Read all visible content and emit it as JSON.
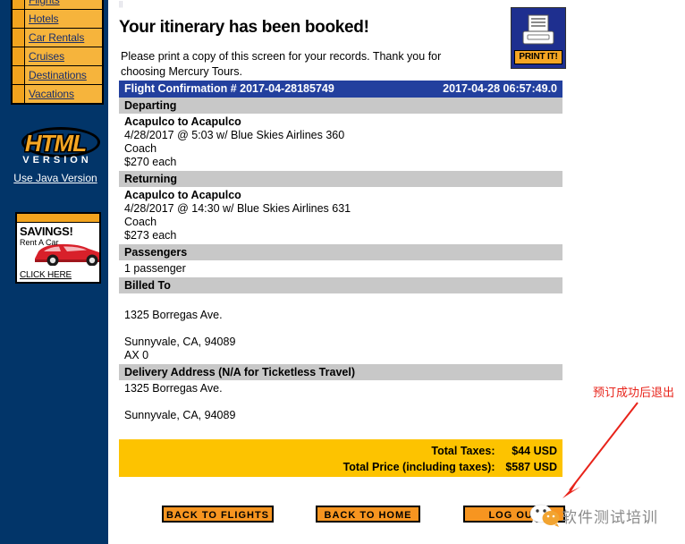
{
  "sidebar": {
    "nav_items": [
      {
        "label": "Flights"
      },
      {
        "label": "Hotels"
      },
      {
        "label": "Car Rentals"
      },
      {
        "label": "Cruises"
      },
      {
        "label": "Destinations"
      },
      {
        "label": "Vacations"
      }
    ],
    "logo": {
      "main_text": "HTML",
      "sub_text": "VERSION",
      "java_link": "Use Java Version"
    },
    "ad": {
      "title": "SAVINGS!",
      "subtitle": "Rent A Car",
      "cta": "CLICK HERE"
    },
    "bg_color": "#023569"
  },
  "main": {
    "page_title": "Your itinerary has been booked!",
    "note": "Please print a copy of this screen for your records. Thank you for choosing Mercury Tours.",
    "print_button": {
      "label": "PRINT IT!",
      "icon": "printer-icon",
      "bg_color": "#1e2f8f",
      "label_bg_color": "#f5a623"
    },
    "confirmation": {
      "title": "Flight Confirmation # 2017-04-28185749",
      "timestamp": "2017-04-28 06:57:49.0",
      "bar_color": "#23409e"
    },
    "sections": [
      {
        "heading": "Departing",
        "route": "Acapulco to Acapulco",
        "detail": "4/28/2017 @ 5:03 w/ Blue Skies Airlines 360",
        "cabin": "Coach",
        "price": "$270 each"
      },
      {
        "heading": "Returning",
        "route": "Acapulco to Acapulco",
        "detail": "4/28/2017 @ 14:30 w/ Blue Skies Airlines 631",
        "cabin": "Coach",
        "price": "$273 each"
      }
    ],
    "passengers": {
      "heading": "Passengers",
      "count_text": "1 passenger"
    },
    "billed_to": {
      "heading": "Billed To",
      "name": "",
      "street": "1325 Borregas Ave.",
      "line2": "",
      "city_state_zip": "Sunnyvale, CA, 94089",
      "card": "AX 0"
    },
    "delivery_address": {
      "heading": "Delivery Address (N/A for Ticketless Travel)",
      "street": "1325 Borregas Ave.",
      "line2": "",
      "city_state_zip": "Sunnyvale, CA, 94089"
    },
    "totals": {
      "taxes_label": "Total Taxes:",
      "taxes_value": "$44 USD",
      "price_label": "Total Price (including taxes):",
      "price_value": "$587 USD",
      "bg_color": "#fdc300"
    },
    "buttons": [
      {
        "label": "BACK TO FLIGHTS"
      },
      {
        "label": "BACK TO HOME"
      },
      {
        "label": "LOG OUT"
      }
    ],
    "button_color": "#f79520"
  },
  "annotation": {
    "text": "预订成功后退出",
    "color": "#e8231a"
  },
  "watermark": {
    "text": "软件测试培训",
    "icon": "wechat-icon"
  }
}
